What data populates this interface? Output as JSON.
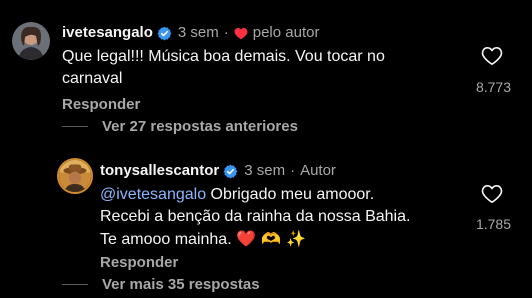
{
  "comment1": {
    "username": "ivetesangalo",
    "time": "3 sem",
    "liked_by_author_label": "pelo autor",
    "text": "Que legal!!! Música boa demais. Vou tocar no carnaval",
    "reply_label": "Responder",
    "like_count": "8.773",
    "view_previous_label": "Ver 27 respostas anteriores"
  },
  "comment2": {
    "username": "tonysallescantor",
    "time": "3 sem",
    "author_label": "Autor",
    "mention": "@ivetesangalo",
    "text_line1_rest": " Obrigado meu amooor.",
    "text_line2": "Recebi a benção da rainha da nossa Bahia.",
    "text_line3": "Te amooo mainha. ",
    "emojis": "❤️ 🫶 ✨",
    "reply_label": "Responder",
    "like_count": "1.785",
    "view_more_label": "Ver mais 35 respostas"
  },
  "colors": {
    "background": "#000000",
    "text": "#f5f5f5",
    "secondary": "#a8a8a8",
    "mention": "#8bb6ff",
    "verified": "#3897f0",
    "heart_red": "#ff3040"
  }
}
